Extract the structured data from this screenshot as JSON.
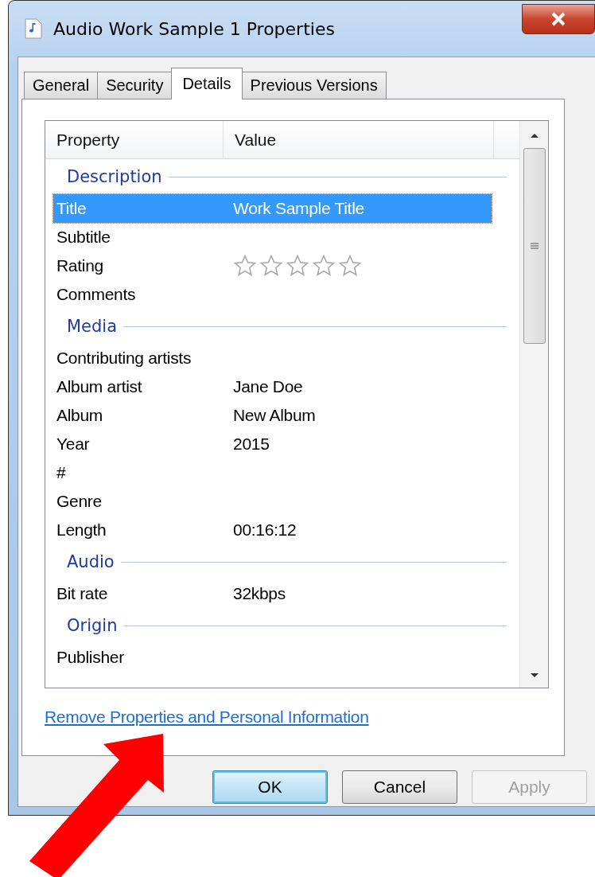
{
  "window": {
    "title": "Audio Work Sample 1 Properties"
  },
  "tabs": [
    {
      "label": "General",
      "selected": false
    },
    {
      "label": "Security",
      "selected": false
    },
    {
      "label": "Details",
      "selected": true
    },
    {
      "label": "Previous Versions",
      "selected": false
    }
  ],
  "columns": [
    "Property",
    "Value"
  ],
  "sections": [
    {
      "title": "Description",
      "rows": [
        {
          "kind": "text",
          "property": "Title",
          "value": "Work Sample Title",
          "selected": true
        },
        {
          "kind": "text",
          "property": "Subtitle",
          "selected": false
        },
        {
          "kind": "rating",
          "property": "Rating",
          "stars": 0,
          "selected": false
        },
        {
          "kind": "text",
          "property": "Comments",
          "selected": false
        }
      ]
    },
    {
      "title": "Media",
      "rows": [
        {
          "kind": "text",
          "property": "Contributing artists",
          "selected": false
        },
        {
          "kind": "text",
          "property": "Album artist",
          "value": "Jane Doe",
          "selected": false
        },
        {
          "kind": "text",
          "property": "Album",
          "value": "New Album",
          "selected": false
        },
        {
          "kind": "text",
          "property": "Year",
          "value": "2015",
          "selected": false
        },
        {
          "kind": "text",
          "property": "#",
          "selected": false
        },
        {
          "kind": "text",
          "property": "Genre",
          "selected": false
        },
        {
          "kind": "text",
          "property": "Length",
          "value": "00:16:12",
          "selected": false
        }
      ]
    },
    {
      "title": "Audio",
      "rows": [
        {
          "kind": "text",
          "property": "Bit rate",
          "value": "32kbps",
          "selected": false
        }
      ]
    },
    {
      "title": "Origin",
      "rows": [
        {
          "kind": "text",
          "property": "Publisher",
          "selected": false
        }
      ]
    }
  ],
  "link": "Remove Properties and Personal Information",
  "buttons": [
    {
      "label": "OK",
      "default": true,
      "disabled": false
    },
    {
      "label": "Cancel",
      "default": false,
      "disabled": false
    },
    {
      "label": "Apply",
      "default": false,
      "disabled": true
    }
  ]
}
